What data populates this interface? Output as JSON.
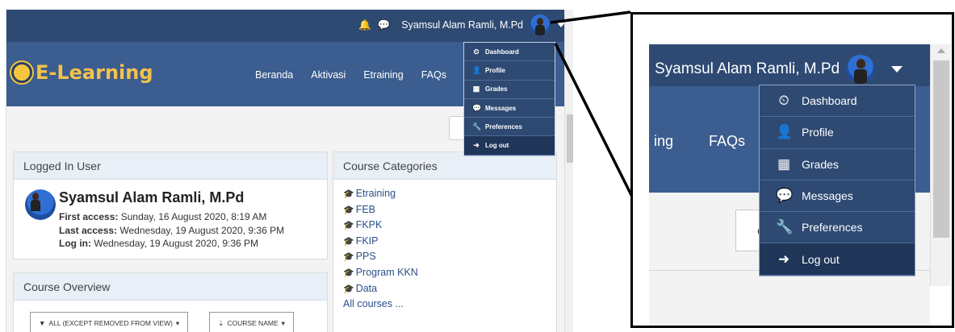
{
  "header": {
    "user_name": "Syamsul Alam Ramli, M.Pd",
    "bell_icon": "bell-icon",
    "chat_icon": "chat-icon"
  },
  "brand": {
    "logo_text": "E-Learning"
  },
  "nav": {
    "items": [
      {
        "label": "Beranda"
      },
      {
        "label": "Aktivasi"
      },
      {
        "label": "Etraining"
      },
      {
        "label": "FAQs"
      }
    ]
  },
  "user_menu": {
    "items": [
      {
        "label": "Dashboard",
        "icon": "dashboard-icon",
        "glyph": "⏲"
      },
      {
        "label": "Profile",
        "icon": "user-icon",
        "glyph": "👤"
      },
      {
        "label": "Grades",
        "icon": "table-icon",
        "glyph": "▦"
      },
      {
        "label": "Messages",
        "icon": "comment-icon",
        "glyph": "💬"
      },
      {
        "label": "Preferences",
        "icon": "wrench-icon",
        "glyph": "🔧"
      },
      {
        "label": "Log out",
        "icon": "sign-out-icon",
        "glyph": "➜"
      }
    ],
    "selected": "Log out"
  },
  "logged_in_user": {
    "header": "Logged In User",
    "name": "Syamsul Alam Ramli, M.Pd",
    "first_access_label": "First access:",
    "first_access_value": "Sunday, 16 August 2020, 8:19 AM",
    "last_access_label": "Last access:",
    "last_access_value": "Wednesday, 19 August 2020, 9:36 PM",
    "login_label": "Log in:",
    "login_value": "Wednesday, 19 August 2020, 9:36 PM"
  },
  "course_overview": {
    "header": "Course Overview",
    "filter_label": "ALL (EXCEPT REMOVED FROM VIEW)",
    "sort_label": "COURSE NAME"
  },
  "course_categories": {
    "header": "Course Categories",
    "items": [
      "Etraining",
      "FEB",
      "FKPK",
      "FKIP",
      "PPS",
      "Program KKN",
      "Data"
    ],
    "all_link": "All courses ..."
  },
  "zoom": {
    "partial_nav_1": "ing",
    "partial_nav_2": "FAQs",
    "stub_char": "C"
  },
  "colors": {
    "topbar": "#2e4a73",
    "navbar": "#3b5d8f",
    "logo": "#f4c24b",
    "link": "#2a4f8a"
  }
}
